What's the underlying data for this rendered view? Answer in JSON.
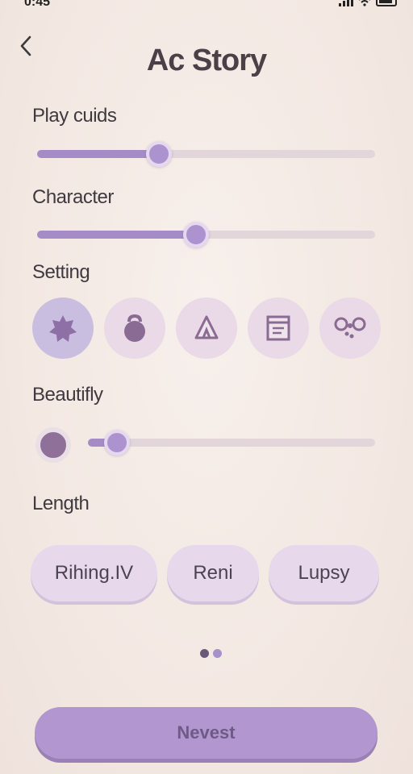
{
  "status_bar": {
    "time": "0:45"
  },
  "header": {
    "back_icon": "chevron-left-icon",
    "title": "Ac Story"
  },
  "sections": {
    "play": {
      "label": "Play cuids",
      "value": 0.36
    },
    "character": {
      "label": "Character",
      "value": 0.47
    },
    "setting": {
      "label": "Setting",
      "options": [
        {
          "icon": "star-badge-icon",
          "selected": true
        },
        {
          "icon": "kettlebell-icon",
          "selected": false
        },
        {
          "icon": "tent-icon",
          "selected": false
        },
        {
          "icon": "box-icon",
          "selected": false
        },
        {
          "icon": "bubbles-icon",
          "selected": false
        }
      ]
    },
    "beautify": {
      "label": "Beautifly",
      "value": 0.1
    },
    "length": {
      "label": "Length",
      "options": [
        "Rihing.IV",
        "Reni",
        "Lupsy"
      ]
    }
  },
  "pager": {
    "count": 2,
    "active": 0
  },
  "cta": {
    "label": "Nevest"
  },
  "colors": {
    "accent": "#a58cc6",
    "track": "#e2d6da",
    "dot_active": "#6b5878",
    "dot_inactive": "#a890c8"
  }
}
